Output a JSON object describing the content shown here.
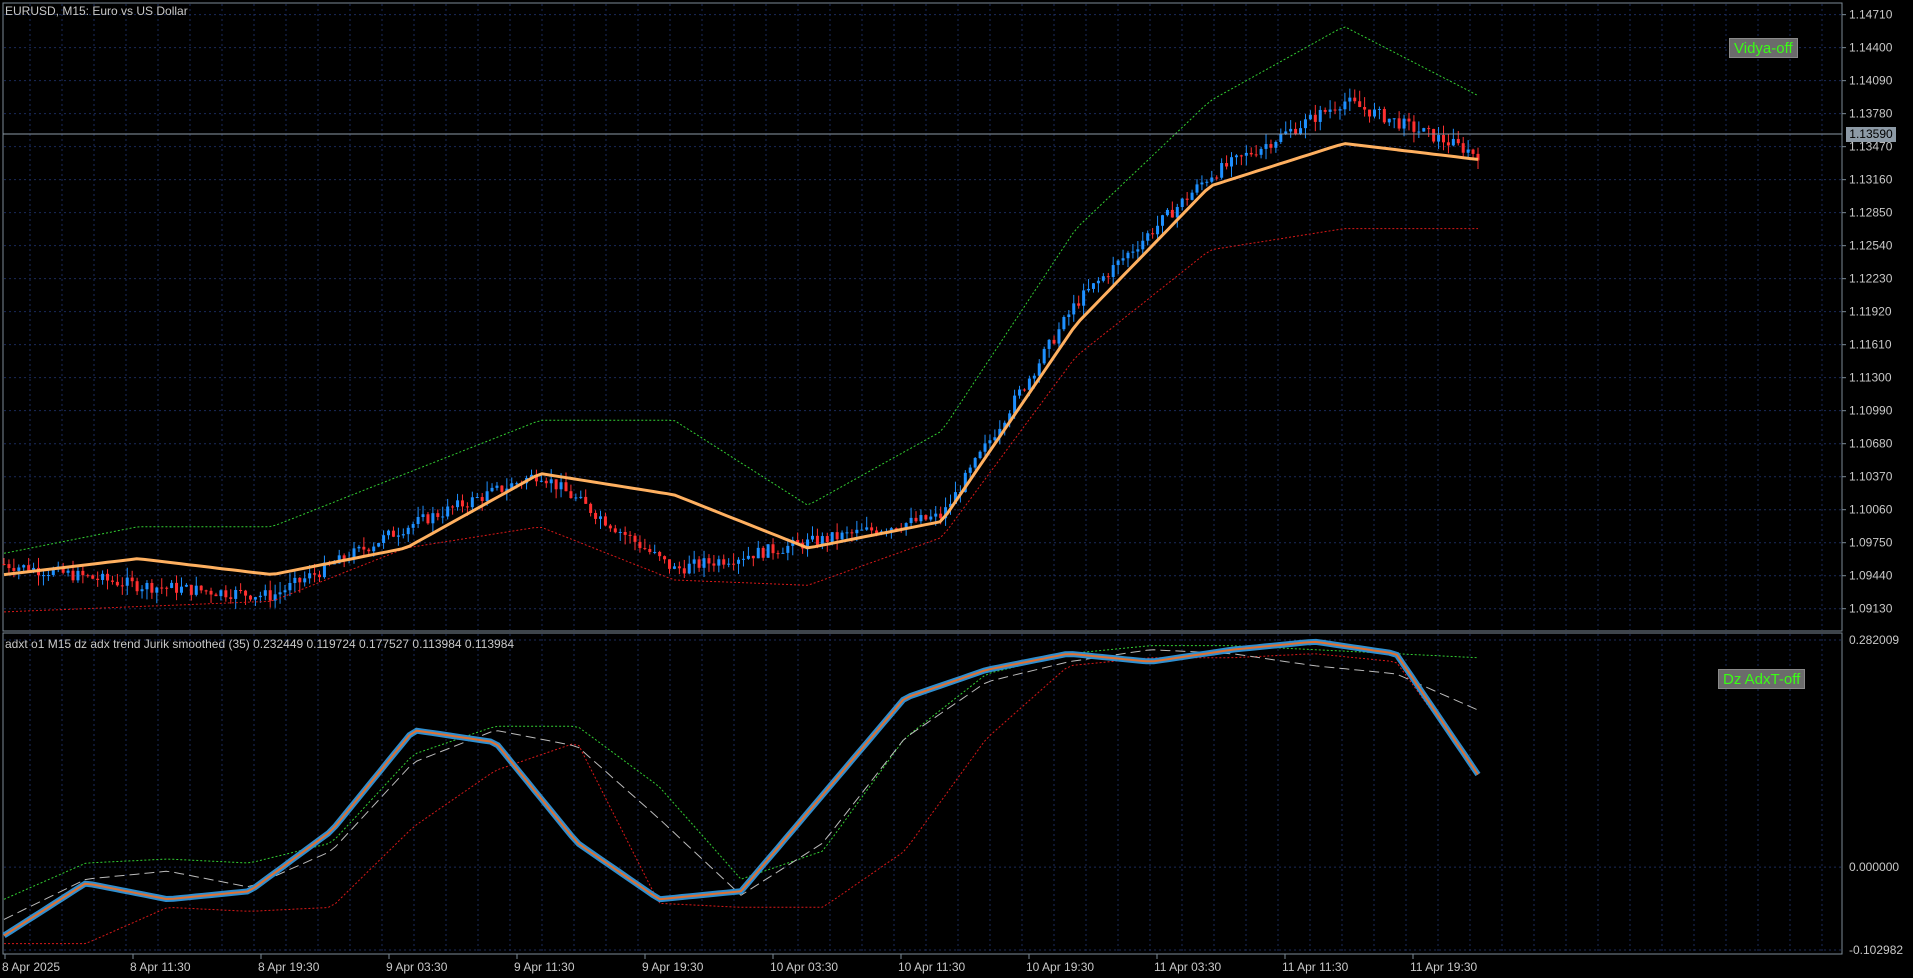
{
  "main_chart": {
    "title": "EURUSD, M15:  Euro vs US Dollar",
    "vidya_button": "Vidya-off",
    "current_price": "1.13590",
    "price_levels": [
      1.1471,
      1.144,
      1.1409,
      1.1378,
      1.1347,
      1.1316,
      1.1285,
      1.1254,
      1.1223,
      1.1192,
      1.1161,
      1.113,
      1.1099,
      1.1068,
      1.1037,
      1.1006,
      1.0975,
      1.0944,
      1.0913
    ],
    "price_labels": [
      "1.14710",
      "1.14400",
      "1.14090",
      "1.13780",
      "1.13470",
      "1.13160",
      "1.12850",
      "1.12540",
      "1.12230",
      "1.11920",
      "1.11610",
      "1.11300",
      "1.10990",
      "1.10680",
      "1.10370",
      "1.10060",
      "1.09750",
      "1.09440",
      "1.09130"
    ],
    "colors": {
      "bull": "#1e90ff",
      "bear": "#ff3030",
      "ma_up": "#2f8fff",
      "ma_flat": "#ffb060",
      "upper_band": "#32cd32",
      "lower_band": "#d81818"
    }
  },
  "sub_chart": {
    "title": "adxt o1 M15 dz adx trend Jurik smoothed (35) 0.232449 0.119724 0.177527 0.113984 0.113984",
    "adx_button": "Dz AdxT-off",
    "levels": [
      "0.282009",
      "0.000000",
      "-0.102982"
    ]
  },
  "time_axis": {
    "labels": [
      "8 Apr 2025",
      "8 Apr 11:30",
      "8 Apr 19:30",
      "9 Apr 03:30",
      "9 Apr 11:30",
      "9 Apr 19:30",
      "10 Apr 03:30",
      "10 Apr 11:30",
      "10 Apr 19:30",
      "11 Apr 03:30",
      "11 Apr 11:30",
      "11 Apr 19:30"
    ]
  },
  "chart_data": {
    "type": "candlestick",
    "symbol": "EURUSD",
    "timeframe": "M15",
    "ylim": [
      1.0893,
      1.1481
    ],
    "x": [
      "8 Apr 2025",
      "8 Apr 11:30",
      "8 Apr 19:30",
      "9 Apr 03:30",
      "9 Apr 11:30",
      "9 Apr 19:30",
      "10 Apr 03:30",
      "10 Apr 11:30",
      "10 Apr 19:30",
      "11 Apr 03:30",
      "11 Apr 11:30",
      "11 Apr 19:30"
    ],
    "close": [
      1.0955,
      1.0935,
      1.0925,
      1.099,
      1.104,
      1.095,
      1.0975,
      1.1,
      1.12,
      1.132,
      1.139,
      1.134
    ],
    "ma": [
      1.0945,
      1.096,
      1.0945,
      1.097,
      1.104,
      1.102,
      1.097,
      1.0995,
      1.118,
      1.131,
      1.135,
      1.1335
    ],
    "upper_band": [
      1.0965,
      1.099,
      1.099,
      1.104,
      1.109,
      1.109,
      1.101,
      1.108,
      1.127,
      1.139,
      1.146,
      1.1395
    ],
    "lower_band": [
      1.091,
      1.0915,
      1.092,
      1.097,
      1.099,
      1.094,
      1.0935,
      1.098,
      1.115,
      1.125,
      1.127,
      1.127
    ],
    "sub_ylim": [
      -0.102982,
      0.282009
    ],
    "adx": [
      -0.085,
      -0.02,
      -0.04,
      -0.03,
      0.045,
      0.17,
      0.155,
      0.03,
      -0.04,
      -0.03,
      0.09,
      0.21,
      0.245,
      0.265,
      0.255,
      0.27,
      0.28,
      0.265,
      0.115
    ],
    "adx_signal": [
      -0.065,
      -0.015,
      -0.005,
      -0.025,
      0.02,
      0.13,
      0.17,
      0.15,
      0.06,
      -0.035,
      0.03,
      0.16,
      0.23,
      0.255,
      0.27,
      0.265,
      0.25,
      0.24,
      0.195
    ],
    "adx_upper": [
      -0.04,
      0.005,
      0.01,
      0.005,
      0.03,
      0.14,
      0.175,
      0.175,
      0.1,
      -0.015,
      0.02,
      0.16,
      0.24,
      0.265,
      0.275,
      0.275,
      0.27,
      0.265,
      0.26
    ],
    "adx_lower": [
      -0.095,
      -0.095,
      -0.05,
      -0.055,
      -0.05,
      0.05,
      0.12,
      0.155,
      -0.045,
      -0.05,
      -0.05,
      0.02,
      0.16,
      0.25,
      0.26,
      0.26,
      0.265,
      0.255,
      0.115
    ]
  }
}
